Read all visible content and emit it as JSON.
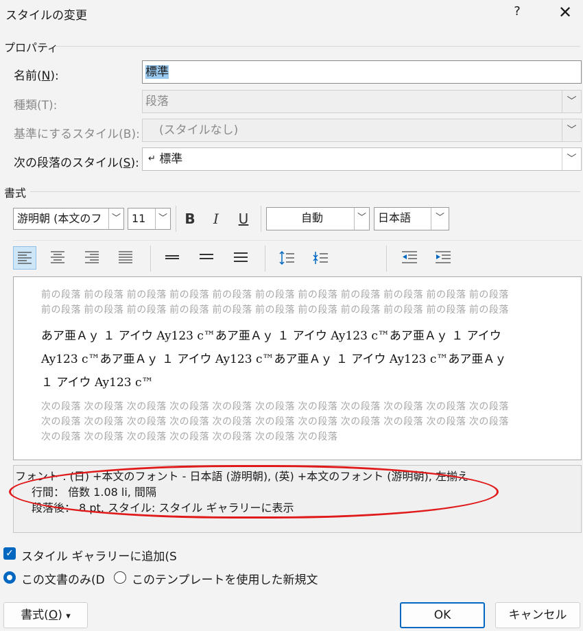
{
  "window": {
    "title": "スタイルの変更",
    "help": "?",
    "close": "✕"
  },
  "properties": {
    "section_label": "プロパティ",
    "name_label_pre": "名前(",
    "name_label_key": "N",
    "name_label_post": "):",
    "name_value": "標準",
    "type_label": "種類(T):",
    "type_value": "段落",
    "based_label": "基準にするスタイル(B):",
    "based_value": "(スタイルなし)",
    "next_label_pre": "次の段落のスタイル(",
    "next_label_key": "S",
    "next_label_post": "):",
    "next_icon": "↵",
    "next_value": "標準"
  },
  "format": {
    "section_label": "書式",
    "font_name": "游明朝 (本文のフ",
    "font_size": "11",
    "bold": "B",
    "italic": "I",
    "underline": "U",
    "color": "自動",
    "language": "日本語"
  },
  "preview": {
    "prev_line1": "前の段落 前の段落 前の段落 前の段落 前の段落 前の段落 前の段落 前の段落 前の段落 前の段落 前の段落",
    "prev_line2": "前の段落 前の段落 前の段落 前の段落 前の段落 前の段落 前の段落 前の段落 前の段落 前の段落 前の段落",
    "sample_line1": "あア亜Ａｙ １ アイウ Ay123 c™あア亜Ａｙ １ アイウ Ay123 c™あア亜Ａｙ １ アイウ",
    "sample_line2": "Ay123 c™あア亜Ａｙ １ アイウ Ay123 c™あア亜Ａｙ １ アイウ Ay123 c™あア亜Ａｙ",
    "sample_line3": "１ アイウ Ay123 c™",
    "next_line1": "次の段落 次の段落 次の段落 次の段落 次の段落 次の段落 次の段落 次の段落 次の段落 次の段落 次の段落",
    "next_line2": "次の段落 次の段落 次の段落 次の段落 次の段落 次の段落 次の段落 次の段落 次の段落 次の段落 次の段落",
    "next_line3": "次の段落 次の段落 次の段落 次の段落 次の段落 次の段落 次の段落"
  },
  "description": {
    "line1": "フォント : (日) +本文のフォント - 日本語 (游明朝), (英) +本文のフォント (游明朝), 左揃え",
    "line2": "行間： 倍数 1.08 li, 間隔",
    "line3": "段落後： 8 pt, スタイル: スタイル ギャラリーに表示"
  },
  "options": {
    "add_gallery": "スタイル ギャラリーに追加(S",
    "this_doc": "この文書のみ(D",
    "template": "このテンプレートを使用した新規文"
  },
  "buttons": {
    "format_pre": "書式(",
    "format_key": "O",
    "format_post": ")",
    "format_arrow": "▾",
    "ok": "OK",
    "cancel": "キャンセル"
  },
  "colors": {
    "accent": "#0067c0",
    "highlight": "#e01a1a",
    "selection": "#99c9ef"
  }
}
